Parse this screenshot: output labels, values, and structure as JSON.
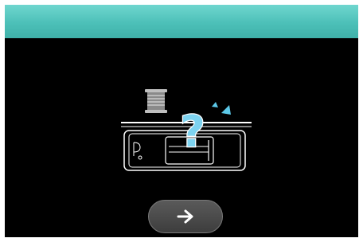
{
  "header": {
    "title": ""
  },
  "illustration": {
    "icons": [
      "thread-spool-icon",
      "bobbin-case-icon",
      "question-mark-icon",
      "sparkle-icon"
    ]
  },
  "navigation": {
    "next_icon": "arrow-right-icon"
  },
  "colors": {
    "header_teal": "#4cc0b8",
    "screen_background": "#000000",
    "question_mark": "#7dd3f0",
    "sparkle": "#5cc8e8",
    "button_fill": "#4a4a4a"
  }
}
